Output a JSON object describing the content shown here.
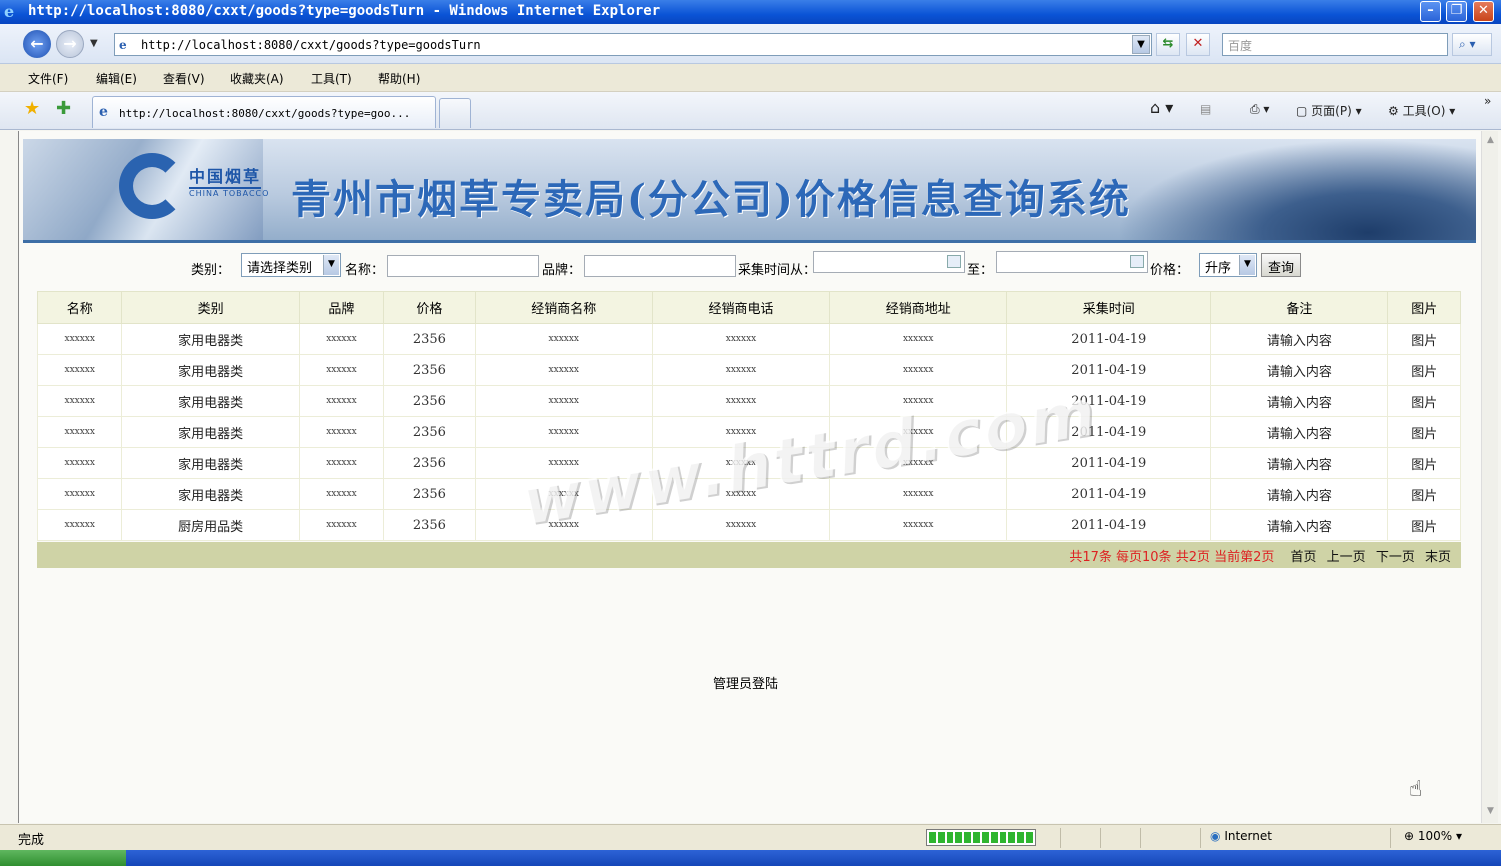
{
  "window": {
    "title": "http://localhost:8080/cxxt/goods?type=goodsTurn - Windows Internet Explorer"
  },
  "addressbar": {
    "url": "http://localhost:8080/cxxt/goods?type=goodsTurn",
    "search_placeholder": "百度"
  },
  "menu": [
    "文件(F)",
    "编辑(E)",
    "查看(V)",
    "收藏夹(A)",
    "工具(T)",
    "帮助(H)"
  ],
  "tab": {
    "title": "http://localhost:8080/cxxt/goods?type=goo..."
  },
  "commandbar": {
    "page": "页面(P)",
    "tools": "工具(O)"
  },
  "banner": {
    "logo_text": "中国烟草",
    "logo_sub": "CHINA TOBACCO",
    "title": "青州市烟草专卖局(分公司)价格信息查询系统"
  },
  "search": {
    "category_label": "类别：",
    "category_value": "请选择类别",
    "name_label": "名称：",
    "brand_label": "品牌：",
    "time_from_label": "采集时间从：",
    "time_to_label": "至：",
    "price_label": "价格：",
    "price_order": "升序",
    "query_button": "查询"
  },
  "table": {
    "headers": [
      "名称",
      "类别",
      "品牌",
      "价格",
      "经销商名称",
      "经销商电话",
      "经销商地址",
      "采集时间",
      "备注",
      "图片"
    ],
    "rows": [
      [
        "xxxxxx",
        "家用电器类",
        "xxxxxx",
        "2356",
        "xxxxxx",
        "xxxxxx",
        "xxxxxx",
        "2011-04-19",
        "请输入内容",
        "图片"
      ],
      [
        "xxxxxx",
        "家用电器类",
        "xxxxxx",
        "2356",
        "xxxxxx",
        "xxxxxx",
        "xxxxxx",
        "2011-04-19",
        "请输入内容",
        "图片"
      ],
      [
        "xxxxxx",
        "家用电器类",
        "xxxxxx",
        "2356",
        "xxxxxx",
        "xxxxxx",
        "xxxxxx",
        "2011-04-19",
        "请输入内容",
        "图片"
      ],
      [
        "xxxxxx",
        "家用电器类",
        "xxxxxx",
        "2356",
        "xxxxxx",
        "xxxxxx",
        "xxxxxx",
        "2011-04-19",
        "请输入内容",
        "图片"
      ],
      [
        "xxxxxx",
        "家用电器类",
        "xxxxxx",
        "2356",
        "xxxxxx",
        "xxxxxx",
        "xxxxxx",
        "2011-04-19",
        "请输入内容",
        "图片"
      ],
      [
        "xxxxxx",
        "家用电器类",
        "xxxxxx",
        "2356",
        "xxxxxx",
        "xxxxxx",
        "xxxxxx",
        "2011-04-19",
        "请输入内容",
        "图片"
      ],
      [
        "xxxxxx",
        "厨房用品类",
        "xxxxxx",
        "2356",
        "xxxxxx",
        "xxxxxx",
        "xxxxxx",
        "2011-04-19",
        "请输入内容",
        "图片"
      ]
    ]
  },
  "pager": {
    "summary": "共17条 每页10条 共2页 当前第2页",
    "first": "首页",
    "prev": "上一页",
    "next": "下一页",
    "last": "末页"
  },
  "admin_link": "管理员登陆",
  "watermark": "www.httrd.com",
  "statusbar": {
    "status": "完成",
    "zone": "Internet",
    "zoom": "100%"
  },
  "colors": {
    "titlebar": "#0b54d6",
    "banner_title": "#2c68b8",
    "table_header": "#f3f4e1",
    "pager_bg": "#cfd3a6",
    "pager_summary": "#dd2222"
  }
}
